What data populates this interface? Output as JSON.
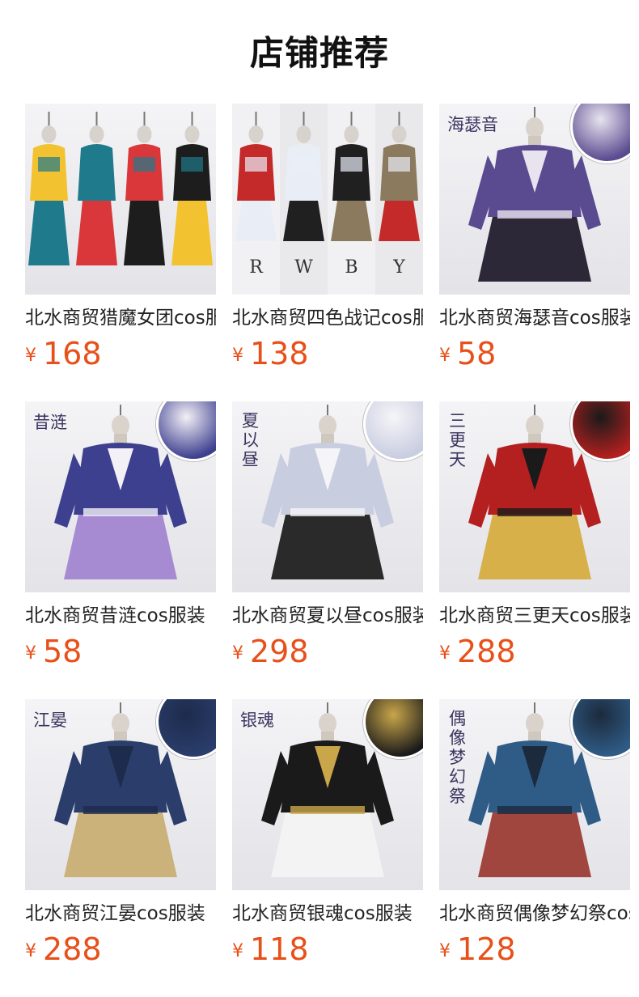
{
  "page_title": "店铺推荐",
  "currency_symbol": "¥",
  "products": [
    {
      "title": "北水商贸猎魔女团cos服",
      "price": "168",
      "icon": "costume-set-icon",
      "thumb_label": "",
      "colors": [
        "#f2c230",
        "#1f7a8c",
        "#d9373a",
        "#1d1d1d"
      ]
    },
    {
      "title": "北水商贸四色战记cos服",
      "price": "138",
      "icon": "costume-set-icon",
      "thumb_label": "",
      "colors": [
        "#c42a2a",
        "#e9eef6",
        "#202020",
        "#8b7a5e"
      ],
      "variants": [
        "R",
        "W",
        "B",
        "Y"
      ]
    },
    {
      "title": "北水商贸海瑟音cos服装",
      "price": "58",
      "icon": "costume-icon",
      "thumb_label": "海瑟音",
      "colors": [
        "#5a4a8f",
        "#e7e4ef",
        "#2d2838"
      ]
    },
    {
      "title": "北水商贸昔涟cos服装",
      "price": "58",
      "icon": "costume-icon",
      "thumb_label": "昔涟",
      "colors": [
        "#3d3f8f",
        "#f3f0f6",
        "#a78bd2"
      ]
    },
    {
      "title": "北水商贸夏以昼cos服装",
      "price": "298",
      "icon": "costume-icon",
      "thumb_label": "夏以昼",
      "colors": [
        "#c9cde0",
        "#f5f5f8",
        "#2a2a2a"
      ]
    },
    {
      "title": "北水商贸三更天cos服装",
      "price": "288",
      "icon": "costume-icon",
      "thumb_label": "三更天",
      "colors": [
        "#b3201f",
        "#1a1a1a",
        "#d8b04a"
      ]
    },
    {
      "title": "北水商贸江晏cos服装",
      "price": "288",
      "icon": "costume-icon",
      "thumb_label": "江晏",
      "colors": [
        "#2a3d6b",
        "#1d2b4c",
        "#cbb27a"
      ]
    },
    {
      "title": "北水商贸银魂cos服装",
      "price": "118",
      "icon": "costume-icon",
      "thumb_label": "银魂",
      "colors": [
        "#1a1a1a",
        "#c9a64a",
        "#f3f3f3"
      ]
    },
    {
      "title": "北水商贸偶像梦幻祭cos服装",
      "price": "128",
      "icon": "costume-icon",
      "thumb_label": "偶像梦幻祭",
      "colors": [
        "#2f5c86",
        "#1c2a3d",
        "#a0463e"
      ]
    }
  ]
}
